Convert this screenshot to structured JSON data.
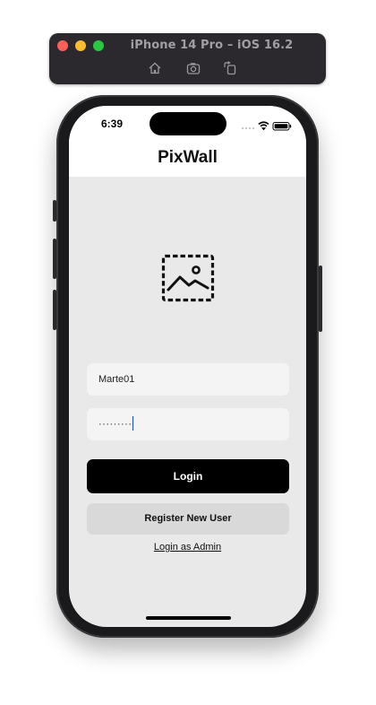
{
  "simulator": {
    "window_title": "iPhone 14 Pro – iOS 16.2",
    "toolbar_icons": [
      "home-icon",
      "screenshot-icon",
      "rotate-icon"
    ]
  },
  "status_bar": {
    "time": "6:39",
    "icons": [
      "cellular-icon",
      "wifi-icon",
      "battery-icon"
    ]
  },
  "app": {
    "title": "PixWall",
    "logo_icon": "image-placeholder-icon"
  },
  "form": {
    "username_value": "Marte01",
    "password_masked": "·········",
    "login_label": "Login",
    "register_label": "Register New User",
    "admin_link_label": "Login as Admin"
  },
  "colors": {
    "screen_background": "#e9e9e9",
    "header_background": "#ffffff",
    "login_button": "#000000",
    "register_button": "#d9d9d9",
    "input_background": "#f4f4f4"
  }
}
